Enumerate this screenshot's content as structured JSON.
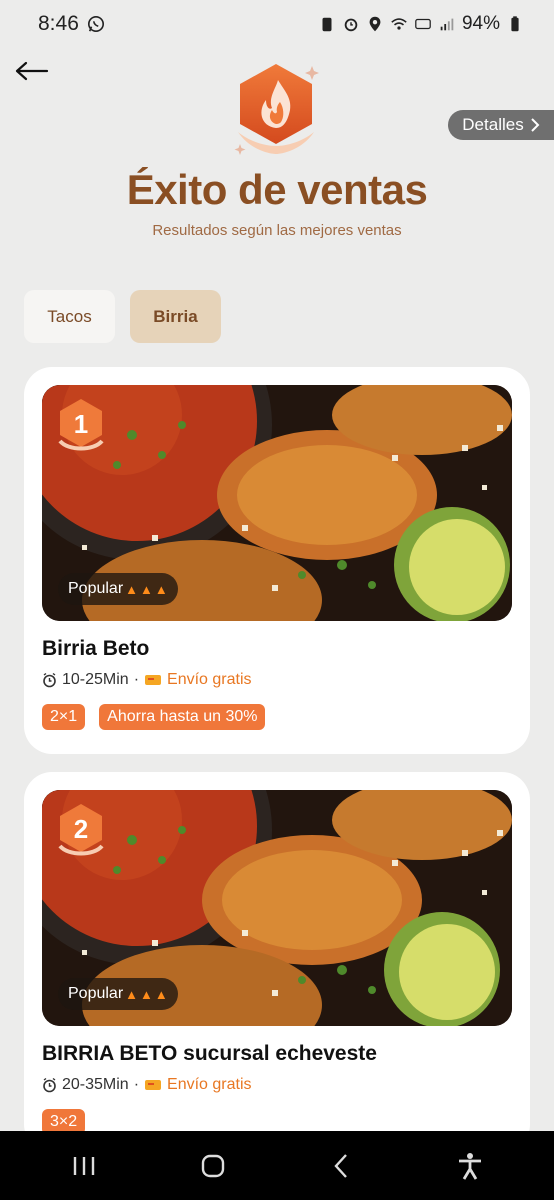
{
  "status": {
    "time": "8:46",
    "battery": "94%"
  },
  "header": {
    "details_label": "Detalles",
    "title": "Éxito de ventas",
    "subtitle": "Resultados según las mejores ventas"
  },
  "tabs": [
    {
      "label": "Tacos",
      "selected": false
    },
    {
      "label": "Birria",
      "selected": true
    }
  ],
  "cards": [
    {
      "rank": "1",
      "tag": "Popular",
      "name": "Birria Beto",
      "time": "10-25Min",
      "separator": "·",
      "shipping": "Envío gratis",
      "promos": [
        "2×1",
        "Ahorra hasta un 30%"
      ]
    },
    {
      "rank": "2",
      "tag": "Popular",
      "name": "BIRRIA BETO sucursal echeveste",
      "time": "20-35Min",
      "separator": "·",
      "shipping": "Envío gratis",
      "promos": [
        "3×2"
      ]
    }
  ],
  "colors": {
    "accent": "#8a4f23",
    "promo": "#f0773a",
    "free_shipping": "#e87722"
  },
  "icons": [
    "whatsapp-icon",
    "back-arrow-icon",
    "flame-hexagon-icon",
    "chevron-right-icon",
    "timer-icon",
    "delivery-icon",
    "flame-icon"
  ]
}
